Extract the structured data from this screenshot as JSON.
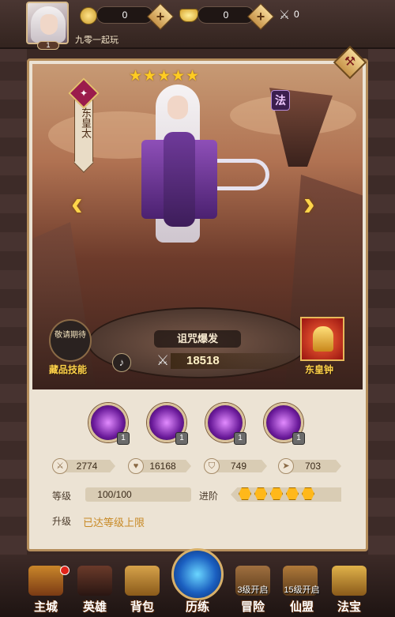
{
  "player": {
    "level": "1",
    "name": "九零一起玩"
  },
  "resources": {
    "coin": "0",
    "ingot": "0",
    "stamina": "0"
  },
  "hero": {
    "name": "东皇太",
    "class_badge": "法",
    "stars": 5,
    "skill_display": "诅咒爆发",
    "power": "18518",
    "fame_badge_text": "敬请期待",
    "fame_label": "藏品技能",
    "treasure_label": "东皇钟"
  },
  "skills": [
    {
      "level": "1"
    },
    {
      "level": "1"
    },
    {
      "level": "1"
    },
    {
      "level": "1"
    }
  ],
  "stats": {
    "attack": "2774",
    "hp": "16168",
    "defense": "749",
    "speed": "703"
  },
  "progress": {
    "level_label": "等级",
    "level_value": "100/100",
    "advance_label": "进阶",
    "advance_stars": 5,
    "upgrade_label": "升级",
    "upgrade_status": "已达等级上限"
  },
  "nav": [
    {
      "label": "主城",
      "unlock": ""
    },
    {
      "label": "英雄",
      "unlock": ""
    },
    {
      "label": "背包",
      "unlock": ""
    },
    {
      "label": "历练",
      "unlock": ""
    },
    {
      "label": "冒险",
      "unlock": "3级开启"
    },
    {
      "label": "仙盟",
      "unlock": "15级开启"
    },
    {
      "label": "法宝",
      "unlock": ""
    }
  ],
  "colors": {
    "accent_gold": "#ffd24a",
    "frame": "#b58e5c",
    "hero_purple": "#6f3a9a"
  },
  "icons": {
    "coin": "coin-icon",
    "ingot": "ingot-icon",
    "stamina": "crossed-swords-icon",
    "add": "plus-icon",
    "sound": "speaker-icon",
    "power": "crossed-swords-icon"
  }
}
